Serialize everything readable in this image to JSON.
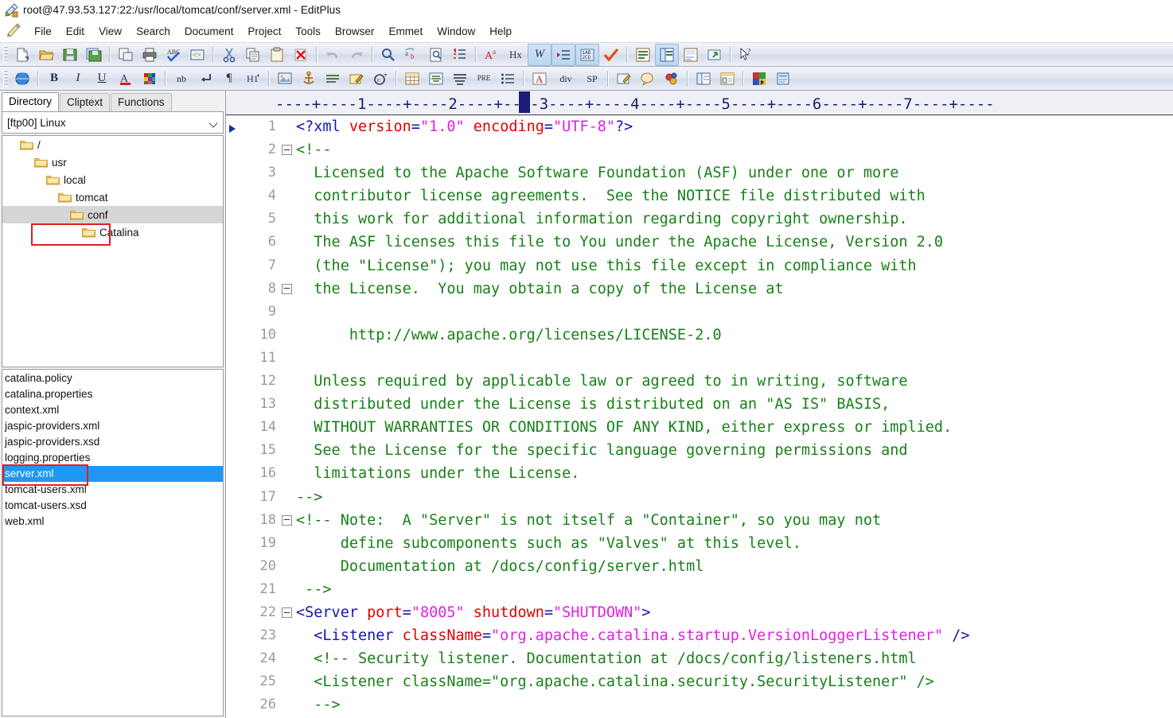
{
  "window": {
    "title": "root@47.93.53.127:22:/usr/local/tomcat/conf/server.xml - EditPlus",
    "app_icon": "editplus-icon"
  },
  "menu": {
    "icon": "pencil-icon",
    "items": [
      "File",
      "Edit",
      "View",
      "Search",
      "Document",
      "Project",
      "Tools",
      "Browser",
      "Emmet",
      "Window",
      "Help"
    ]
  },
  "toolbar1": {
    "buttons": [
      {
        "name": "new-file-icon",
        "tip": "New"
      },
      {
        "name": "open-file-icon",
        "tip": "Open"
      },
      {
        "name": "save-icon",
        "tip": "Save"
      },
      {
        "name": "save-all-icon",
        "tip": "Save All"
      },
      {
        "name": "print-preview-icon",
        "tip": "Print Preview"
      },
      {
        "name": "print-icon",
        "tip": "Print"
      },
      {
        "name": "spellcheck-icon",
        "tip": "Spell Check"
      },
      {
        "name": "view-in-browser-icon",
        "tip": "View in Browser"
      },
      {
        "name": "cut-icon",
        "tip": "Cut"
      },
      {
        "name": "copy-icon",
        "tip": "Copy"
      },
      {
        "name": "paste-icon",
        "tip": "Paste"
      },
      {
        "name": "delete-icon",
        "tip": "Delete"
      },
      {
        "name": "undo-icon",
        "tip": "Undo"
      },
      {
        "name": "redo-icon",
        "tip": "Redo"
      },
      {
        "name": "find-icon",
        "tip": "Find"
      },
      {
        "name": "replace-icon",
        "tip": "Replace"
      },
      {
        "name": "find-in-files-icon",
        "tip": "Find in Files"
      },
      {
        "name": "goto-line-icon",
        "tip": "Go To Line"
      },
      {
        "name": "font-style-icon",
        "tip": "Font"
      },
      {
        "name": "hex-view-icon",
        "tip": "Hex Viewer",
        "label": "Hx"
      },
      {
        "name": "word-wrap-icon",
        "tip": "Word Wrap",
        "label": "W",
        "active": true
      },
      {
        "name": "indent-icon",
        "tip": "Auto Indent",
        "active": true
      },
      {
        "name": "column-marker-icon",
        "tip": "Column Marker",
        "active": true
      },
      {
        "name": "check-icon",
        "tip": "Validate"
      },
      {
        "name": "document-selector-icon",
        "tip": "Document Selector"
      },
      {
        "name": "clip-library-icon",
        "tip": "Cliptext"
      },
      {
        "name": "output-window-icon",
        "tip": "Output Window"
      },
      {
        "name": "ftp-upload-icon",
        "tip": "Upload"
      },
      {
        "name": "help-pointer-icon",
        "tip": "Context Help"
      }
    ]
  },
  "toolbar2": {
    "buttons": [
      {
        "name": "globe-icon",
        "tip": "HTML Page"
      },
      {
        "name": "bold-icon",
        "label": "B"
      },
      {
        "name": "italic-icon",
        "label": "I"
      },
      {
        "name": "underline-icon",
        "label": "U"
      },
      {
        "name": "font-color-icon",
        "label": "A"
      },
      {
        "name": "palette-icon",
        "tip": "Color Picker"
      },
      {
        "name": "nbsp-icon",
        "label": "nb"
      },
      {
        "name": "line-break-icon"
      },
      {
        "name": "paragraph-icon"
      },
      {
        "name": "heading-icon",
        "label": "H1"
      },
      {
        "name": "image-icon"
      },
      {
        "name": "anchor-icon"
      },
      {
        "name": "horizontal-rule-icon"
      },
      {
        "name": "edit-link-icon"
      },
      {
        "name": "copyright-icon"
      },
      {
        "name": "table-icon"
      },
      {
        "name": "align-center-icon"
      },
      {
        "name": "align-justify-icon"
      },
      {
        "name": "preformatted-icon",
        "label": "PRE"
      },
      {
        "name": "list-icon"
      },
      {
        "name": "font-tag-icon",
        "label": "A"
      },
      {
        "name": "div-tag-icon",
        "label": "div"
      },
      {
        "name": "span-tag-icon",
        "label": "SP"
      },
      {
        "name": "form-icon"
      },
      {
        "name": "comment-icon"
      },
      {
        "name": "script-icon"
      },
      {
        "name": "frame-icon"
      },
      {
        "name": "layout-icon"
      },
      {
        "name": "color-chart-icon"
      },
      {
        "name": "preview-panel-icon"
      }
    ]
  },
  "dock": {
    "tabs": [
      {
        "label": "Directory",
        "active": true
      },
      {
        "label": "Cliptext",
        "active": false
      },
      {
        "label": "Functions",
        "active": false
      }
    ],
    "connection": {
      "value": "[ftp00] Linux",
      "chevron": "chevron-down-icon"
    },
    "tree": [
      {
        "label": "/",
        "depth": 0,
        "selected": false
      },
      {
        "label": "usr",
        "depth": 1,
        "selected": false
      },
      {
        "label": "local",
        "depth": 2,
        "selected": false
      },
      {
        "label": "tomcat",
        "depth": 3,
        "selected": false
      },
      {
        "label": "conf",
        "depth": 4,
        "selected": true,
        "highlighted": true
      },
      {
        "label": "Catalina",
        "depth": 5,
        "selected": false
      }
    ],
    "files": [
      {
        "name": "catalina.policy",
        "selected": false
      },
      {
        "name": "catalina.properties",
        "selected": false
      },
      {
        "name": "context.xml",
        "selected": false
      },
      {
        "name": "jaspic-providers.xml",
        "selected": false
      },
      {
        "name": "jaspic-providers.xsd",
        "selected": false
      },
      {
        "name": "logging.properties",
        "selected": false
      },
      {
        "name": "server.xml",
        "selected": true,
        "highlighted": true
      },
      {
        "name": "tomcat-users.xml",
        "selected": false
      },
      {
        "name": "tomcat-users.xsd",
        "selected": false
      },
      {
        "name": "web.xml",
        "selected": false
      }
    ]
  },
  "editor": {
    "ruler": "----+----1----+----2----+----3----+----4----+----5----+----6----+----7----+----",
    "caret_column": 1,
    "colors": {
      "tag": "#1414b4",
      "attribute": "#e00000",
      "value": "#e420e4",
      "comment": "#178117",
      "text": "#000000",
      "line_number": "#9a9a9a",
      "selection": "#2196f3",
      "highlight_box": "#e02020"
    },
    "lines": [
      {
        "n": 1,
        "fold": false,
        "bookmark": true,
        "tokens": [
          {
            "t": "<?xml ",
            "c": "tag"
          },
          {
            "t": "version",
            "c": "attr"
          },
          {
            "t": "=",
            "c": "tag"
          },
          {
            "t": "\"1.0\"",
            "c": "val"
          },
          {
            "t": " ",
            "c": "txt"
          },
          {
            "t": "encoding",
            "c": "attr"
          },
          {
            "t": "=",
            "c": "tag"
          },
          {
            "t": "\"UTF-8\"",
            "c": "val"
          },
          {
            "t": "?>",
            "c": "tag"
          }
        ]
      },
      {
        "n": 2,
        "fold": true,
        "tokens": [
          {
            "t": "<!--",
            "c": "cmt"
          }
        ]
      },
      {
        "n": 3,
        "fold": false,
        "tokens": [
          {
            "t": "  Licensed to the Apache Software Foundation (ASF) under one or more",
            "c": "cmt"
          }
        ]
      },
      {
        "n": 4,
        "fold": false,
        "tokens": [
          {
            "t": "  contributor license agreements.  See the NOTICE file distributed with",
            "c": "cmt"
          }
        ]
      },
      {
        "n": 5,
        "fold": false,
        "tokens": [
          {
            "t": "  this work for additional information regarding copyright ownership.",
            "c": "cmt"
          }
        ]
      },
      {
        "n": 6,
        "fold": false,
        "tokens": [
          {
            "t": "  The ASF licenses this file to You under the Apache License, Version 2.0",
            "c": "cmt"
          }
        ]
      },
      {
        "n": 7,
        "fold": false,
        "tokens": [
          {
            "t": "  (the \"License\"); you may not use this file except in compliance with",
            "c": "cmt"
          }
        ]
      },
      {
        "n": 8,
        "fold": true,
        "tokens": [
          {
            "t": "  the License.  You may obtain a copy of the License at",
            "c": "cmt"
          }
        ]
      },
      {
        "n": 9,
        "fold": false,
        "tokens": []
      },
      {
        "n": 10,
        "fold": false,
        "tokens": [
          {
            "t": "      http://www.apache.org/licenses/LICENSE-2.0",
            "c": "cmt"
          }
        ]
      },
      {
        "n": 11,
        "fold": false,
        "tokens": []
      },
      {
        "n": 12,
        "fold": false,
        "tokens": [
          {
            "t": "  Unless required by applicable law or agreed to in writing, software",
            "c": "cmt"
          }
        ]
      },
      {
        "n": 13,
        "fold": false,
        "tokens": [
          {
            "t": "  distributed under the License is distributed on an \"AS IS\" BASIS,",
            "c": "cmt"
          }
        ]
      },
      {
        "n": 14,
        "fold": false,
        "tokens": [
          {
            "t": "  WITHOUT WARRANTIES OR CONDITIONS OF ANY KIND, either express or implied.",
            "c": "cmt"
          }
        ]
      },
      {
        "n": 15,
        "fold": false,
        "tokens": [
          {
            "t": "  See the License for the specific language governing permissions and",
            "c": "cmt"
          }
        ]
      },
      {
        "n": 16,
        "fold": false,
        "tokens": [
          {
            "t": "  limitations under the License.",
            "c": "cmt"
          }
        ]
      },
      {
        "n": 17,
        "fold": false,
        "tokens": [
          {
            "t": "-->",
            "c": "cmt"
          }
        ]
      },
      {
        "n": 18,
        "fold": true,
        "tokens": [
          {
            "t": "<!-- Note:  A \"Server\" is not itself a \"Container\", so you may not",
            "c": "cmt"
          }
        ]
      },
      {
        "n": 19,
        "fold": false,
        "tokens": [
          {
            "t": "     define subcomponents such as \"Valves\" at this level.",
            "c": "cmt"
          }
        ]
      },
      {
        "n": 20,
        "fold": false,
        "tokens": [
          {
            "t": "     Documentation at /docs/config/server.html",
            "c": "cmt"
          }
        ]
      },
      {
        "n": 21,
        "fold": false,
        "tokens": [
          {
            "t": " -->",
            "c": "cmt"
          }
        ]
      },
      {
        "n": 22,
        "fold": true,
        "tokens": [
          {
            "t": "<Server ",
            "c": "tag"
          },
          {
            "t": "port",
            "c": "attr"
          },
          {
            "t": "=",
            "c": "tag"
          },
          {
            "t": "\"8005\"",
            "c": "val"
          },
          {
            "t": " ",
            "c": "txt"
          },
          {
            "t": "shutdown",
            "c": "attr"
          },
          {
            "t": "=",
            "c": "tag"
          },
          {
            "t": "\"SHUTDOWN\"",
            "c": "val"
          },
          {
            "t": ">",
            "c": "tag"
          }
        ]
      },
      {
        "n": 23,
        "fold": false,
        "tokens": [
          {
            "t": "  <Listener ",
            "c": "tag"
          },
          {
            "t": "className",
            "c": "attr"
          },
          {
            "t": "=",
            "c": "tag"
          },
          {
            "t": "\"org.apache.catalina.startup.VersionLoggerListener\"",
            "c": "val"
          },
          {
            "t": " />",
            "c": "tag"
          }
        ]
      },
      {
        "n": 24,
        "fold": false,
        "tokens": [
          {
            "t": "  <!-- Security listener. Documentation at /docs/config/listeners.html",
            "c": "cmt"
          }
        ]
      },
      {
        "n": 25,
        "fold": false,
        "tokens": [
          {
            "t": "  <Listener className=\"org.apache.catalina.security.SecurityListener\" />",
            "c": "cmt"
          }
        ]
      },
      {
        "n": 26,
        "fold": false,
        "tokens": [
          {
            "t": "  -->",
            "c": "cmt"
          }
        ]
      }
    ]
  }
}
